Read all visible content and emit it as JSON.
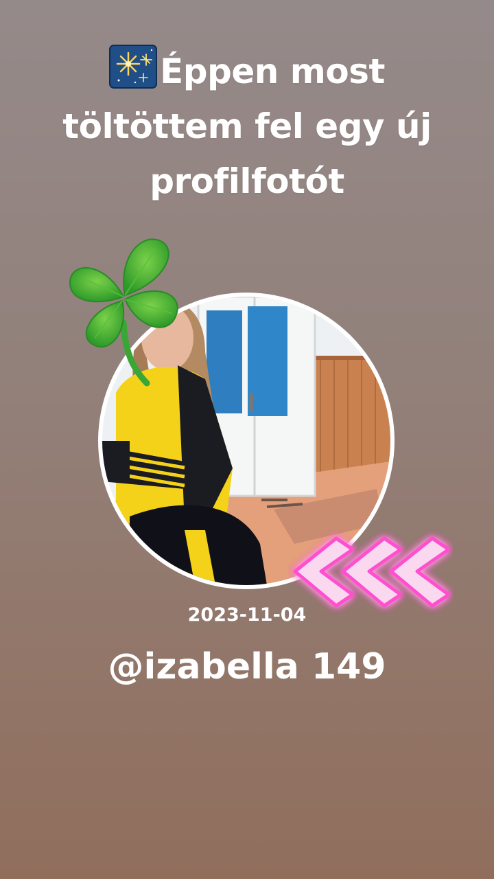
{
  "post": {
    "emoji": "fireworks",
    "headline": "Éppen most töltöttem fel egy új profilfotót",
    "date": "2023-11-04",
    "username": "@izabella 149"
  },
  "profile_photo": {
    "description_icon": "profile-photo",
    "shirt_print": "adidas"
  },
  "stickers": {
    "clover": "four-leaf-clover-sticker",
    "arrows": "neon-chevron-arrows"
  },
  "colors": {
    "background_top": "#958a8a",
    "background_bottom": "#916e5c",
    "text": "#ffffff",
    "neon_pink": "#ff4fd0"
  }
}
